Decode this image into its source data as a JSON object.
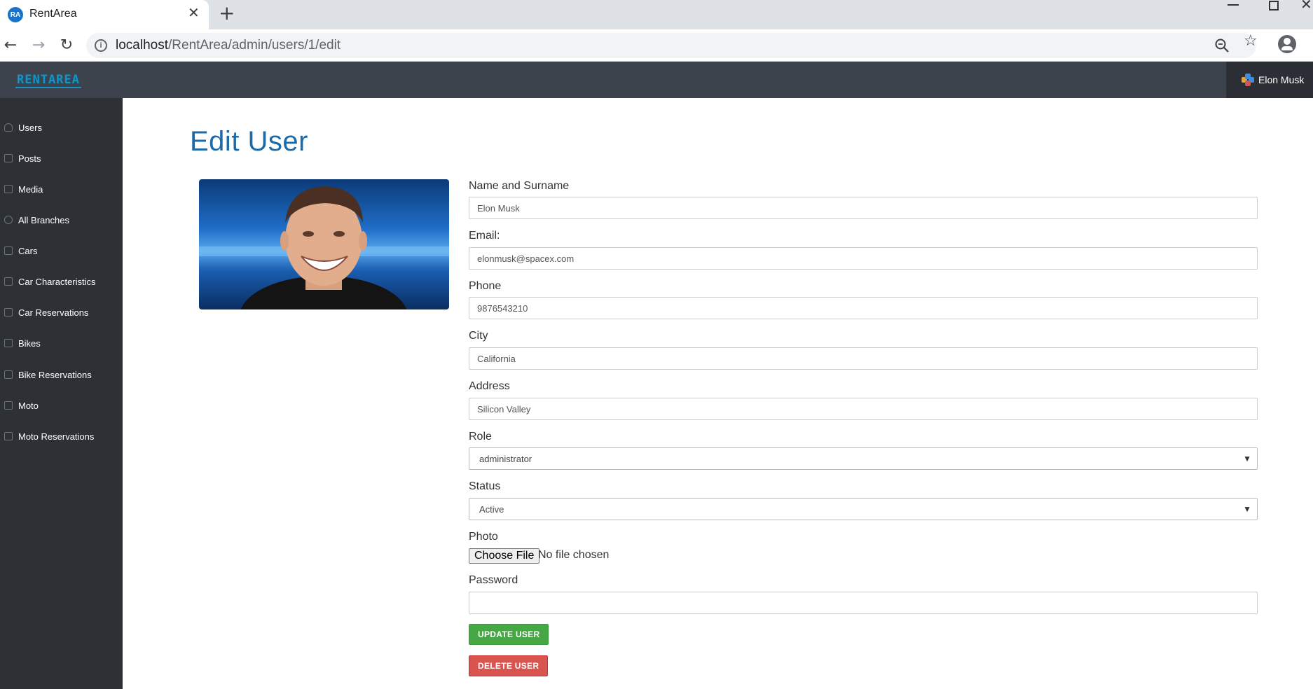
{
  "browser": {
    "tab_title": "RentArea",
    "favicon_text": "RA",
    "url_host": "localhost",
    "url_path": "/RentArea/admin/users/1/edit"
  },
  "header": {
    "logo_text": "RENTAREA",
    "user_name": "Elon Musk"
  },
  "sidebar": {
    "items": [
      {
        "label": "Users",
        "icon": "user-icon"
      },
      {
        "label": "Posts",
        "icon": "file-icon"
      },
      {
        "label": "Media",
        "icon": "image-icon"
      },
      {
        "label": "All Branches",
        "icon": "globe-icon"
      },
      {
        "label": "Cars",
        "icon": "image-icon"
      },
      {
        "label": "Car Characteristics",
        "icon": "image-icon"
      },
      {
        "label": "Car Reservations",
        "icon": "file-icon"
      },
      {
        "label": "Bikes",
        "icon": "image-icon"
      },
      {
        "label": "Bike Reservations",
        "icon": "file-icon"
      },
      {
        "label": "Moto",
        "icon": "image-icon"
      },
      {
        "label": "Moto Reservations",
        "icon": "file-icon"
      }
    ]
  },
  "main": {
    "page_title": "Edit User",
    "form": {
      "name_label": "Name and Surname",
      "name_value": "Elon Musk",
      "email_label": "Email:",
      "email_value": "elonmusk@spacex.com",
      "phone_label": "Phone",
      "phone_value": "9876543210",
      "city_label": "City",
      "city_value": "California",
      "address_label": "Address",
      "address_value": "Silicon Valley",
      "role_label": "Role",
      "role_value": "administrator",
      "status_label": "Status",
      "status_value": "Active",
      "photo_label": "Photo",
      "choose_file_label": "Choose File",
      "file_status": "No file chosen",
      "password_label": "Password",
      "password_value": "",
      "update_button": "UPDATE USER",
      "delete_button": "DELETE USER"
    }
  },
  "colors": {
    "header_bg": "#3d434c",
    "sidebar_bg": "#2d3136",
    "title_color": "#1e6aa8",
    "update_green": "#45a845",
    "delete_red": "#d9534f"
  }
}
